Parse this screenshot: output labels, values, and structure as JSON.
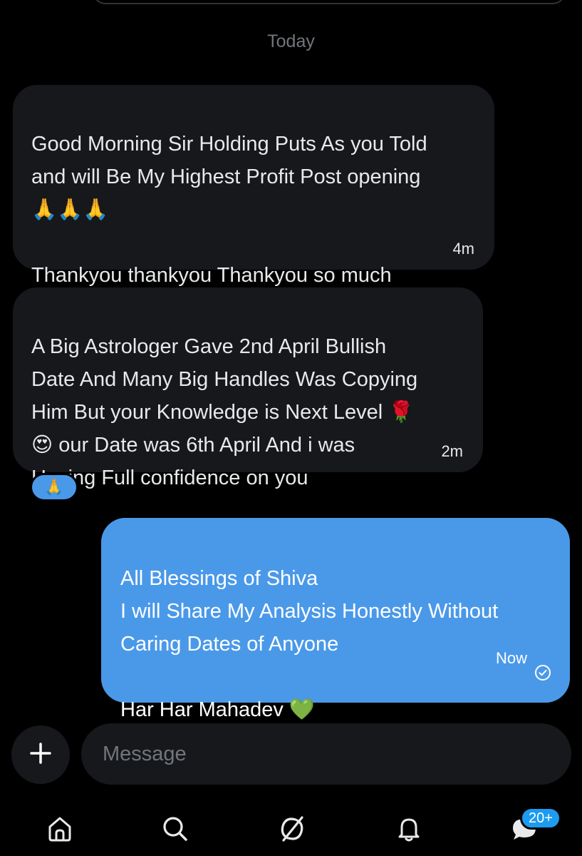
{
  "date_divider": "Today",
  "messages": [
    {
      "direction": "incoming",
      "text": "Good Morning Sir Holding Puts As you Told\nand will Be My Highest Profit Post opening\n🙏🙏🙏\n\nThankyou thankyou Thankyou so much",
      "time": "4m"
    },
    {
      "direction": "incoming",
      "text": "A Big Astrologer Gave 2nd April Bullish\nDate And Many Big Handles Was Copying\nHim But your Knowledge is Next Level 🌹\n😍 our Date was 6th April And i was\nHaving Full confidence on you",
      "time": "2m",
      "reaction": "🙏"
    },
    {
      "direction": "outgoing",
      "text": "All Blessings of Shiva\nI will Share My Analysis Honestly Without\nCaring Dates of Anyone\n\nHar Har Mahadev 💚",
      "time": "Now",
      "status_icon": "read-check-icon"
    }
  ],
  "composer": {
    "add_icon": "plus-icon",
    "placeholder": "Message"
  },
  "bottom_nav": {
    "items": [
      {
        "icon": "home-icon"
      },
      {
        "icon": "search-icon"
      },
      {
        "icon": "grok-icon"
      },
      {
        "icon": "notifications-icon"
      },
      {
        "icon": "messages-icon"
      }
    ],
    "messages_badge": "20+"
  },
  "colors": {
    "background": "#000000",
    "incoming_bubble": "#16181c",
    "outgoing_bubble": "#4a99e9",
    "muted_text": "#71767b",
    "badge": "#1d9bf0"
  }
}
